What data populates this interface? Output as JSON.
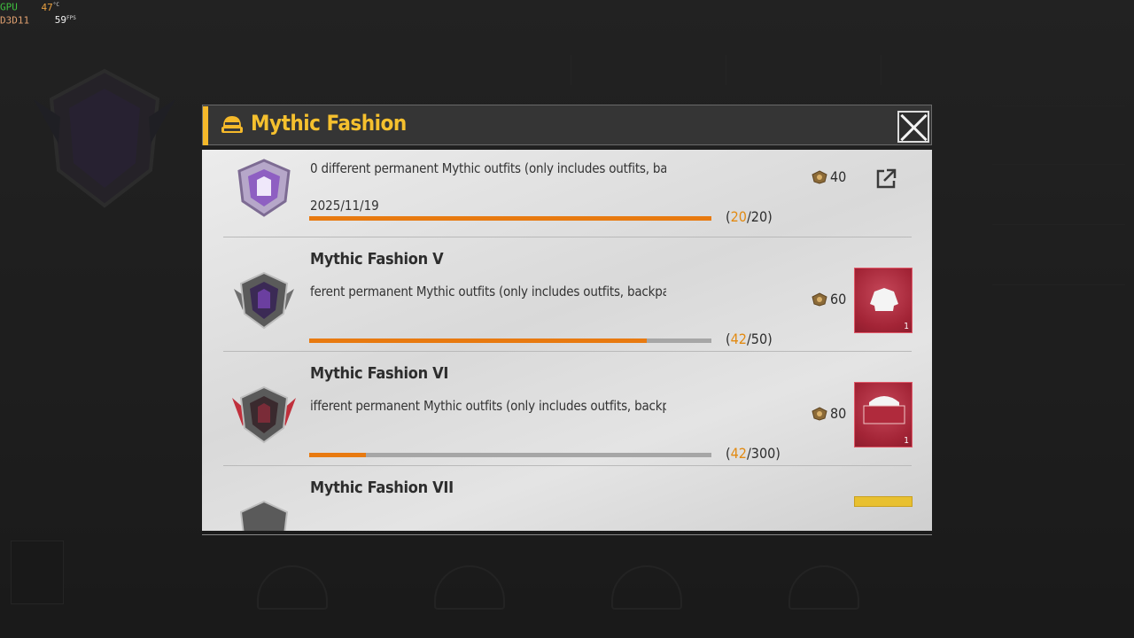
{
  "hud": {
    "gpu_label": "GPU",
    "gpu_temp": "47",
    "temp_unit": "°C",
    "api_label": "D3D11",
    "fps": "59",
    "fps_unit": "FPS"
  },
  "modal": {
    "title": "Mythic Fashion",
    "accent_color": "#f5b92a",
    "rows": [
      {
        "name": "",
        "desc": "0 different permanent Mythic outfits (only includes outfits, bac",
        "date": "2025/11/19",
        "progress_current": "20",
        "progress_total": "20",
        "progress_fraction": 1.0,
        "points": "40",
        "action": "share-icon"
      },
      {
        "name": "Mythic Fashion V",
        "desc": "ferent permanent Mythic outfits (only includes outfits, backpa",
        "progress_current": "42",
        "progress_total": "50",
        "progress_fraction": 0.84,
        "points": "60",
        "reward_qty": "1"
      },
      {
        "name": "Mythic Fashion VI",
        "desc": "ifferent permanent Mythic outfits (only includes outfits, backp",
        "progress_current": "42",
        "progress_total": "300",
        "progress_fraction": 0.14,
        "points": "80",
        "reward_qty": "1"
      },
      {
        "name": "Mythic Fashion VII"
      }
    ]
  }
}
